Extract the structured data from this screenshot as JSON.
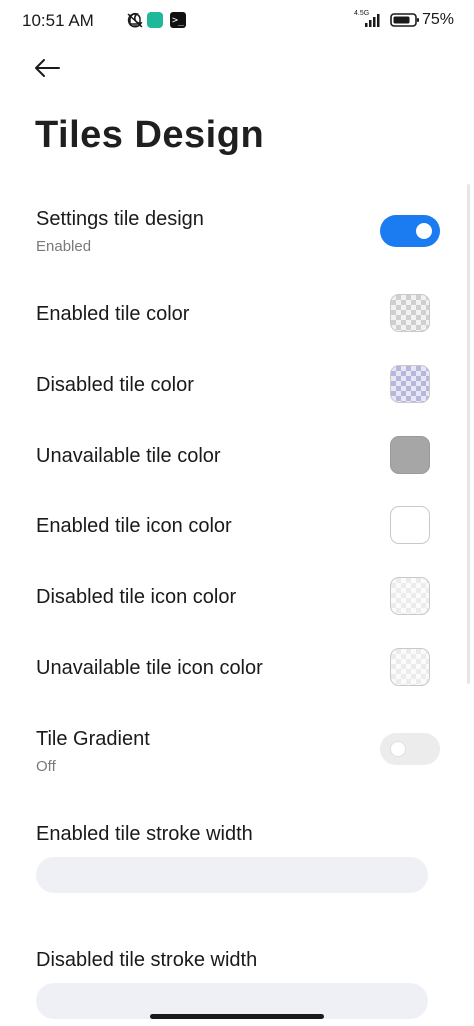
{
  "status_bar": {
    "time": "10:51 AM",
    "network": "4.5G",
    "battery": "75%",
    "icons": [
      "moon-icon",
      "bell-off-icon",
      "app-icon",
      "terminal-icon",
      "signal-icon",
      "battery-icon"
    ]
  },
  "header": {
    "back_icon": "arrow-left-icon",
    "title": "Tiles Design"
  },
  "settings": {
    "settings_tile_design": {
      "title": "Settings tile design",
      "subtitle": "Enabled",
      "state": true,
      "accent": "#1a7cf0"
    },
    "enabled_tile_color": {
      "title": "Enabled tile color",
      "swatch": "checkered-gray"
    },
    "disabled_tile_color": {
      "title": "Disabled tile color",
      "swatch": "checkered-purple"
    },
    "unavailable_tile_color": {
      "title": "Unavailable tile color",
      "swatch": "#a6a6a6"
    },
    "enabled_tile_icon_color": {
      "title": "Enabled tile icon color",
      "swatch": "#ffffff"
    },
    "disabled_tile_icon_color": {
      "title": "Disabled tile icon color",
      "swatch": "checkered-light"
    },
    "unavailable_tile_icon_color": {
      "title": "Unavailable tile icon color",
      "swatch": "checkered-light"
    },
    "tile_gradient": {
      "title": "Tile Gradient",
      "subtitle": "Off",
      "state": false
    },
    "enabled_tile_stroke_width": {
      "title": "Enabled tile stroke width"
    },
    "disabled_tile_stroke_width": {
      "title": "Disabled tile stroke width"
    }
  }
}
